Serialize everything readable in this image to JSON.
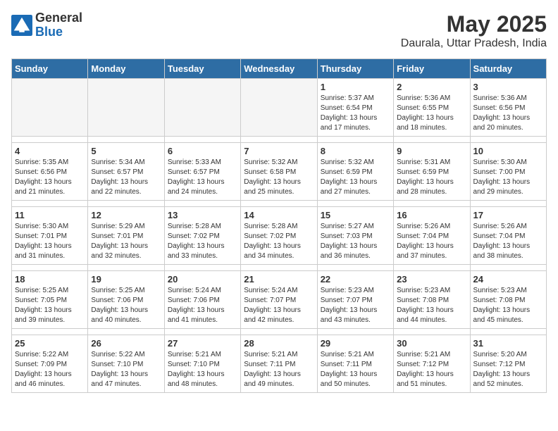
{
  "logo": {
    "general": "General",
    "blue": "Blue"
  },
  "header": {
    "title": "May 2025",
    "subtitle": "Daurala, Uttar Pradesh, India"
  },
  "weekdays": [
    "Sunday",
    "Monday",
    "Tuesday",
    "Wednesday",
    "Thursday",
    "Friday",
    "Saturday"
  ],
  "weeks": [
    [
      {
        "day": "",
        "empty": true
      },
      {
        "day": "",
        "empty": true
      },
      {
        "day": "",
        "empty": true
      },
      {
        "day": "",
        "empty": true
      },
      {
        "day": "1",
        "sunrise": "5:37 AM",
        "sunset": "6:54 PM",
        "daylight": "13 hours and 17 minutes."
      },
      {
        "day": "2",
        "sunrise": "5:36 AM",
        "sunset": "6:55 PM",
        "daylight": "13 hours and 18 minutes."
      },
      {
        "day": "3",
        "sunrise": "5:36 AM",
        "sunset": "6:56 PM",
        "daylight": "13 hours and 20 minutes."
      }
    ],
    [
      {
        "day": "4",
        "sunrise": "5:35 AM",
        "sunset": "6:56 PM",
        "daylight": "13 hours and 21 minutes."
      },
      {
        "day": "5",
        "sunrise": "5:34 AM",
        "sunset": "6:57 PM",
        "daylight": "13 hours and 22 minutes."
      },
      {
        "day": "6",
        "sunrise": "5:33 AM",
        "sunset": "6:57 PM",
        "daylight": "13 hours and 24 minutes."
      },
      {
        "day": "7",
        "sunrise": "5:32 AM",
        "sunset": "6:58 PM",
        "daylight": "13 hours and 25 minutes."
      },
      {
        "day": "8",
        "sunrise": "5:32 AM",
        "sunset": "6:59 PM",
        "daylight": "13 hours and 27 minutes."
      },
      {
        "day": "9",
        "sunrise": "5:31 AM",
        "sunset": "6:59 PM",
        "daylight": "13 hours and 28 minutes."
      },
      {
        "day": "10",
        "sunrise": "5:30 AM",
        "sunset": "7:00 PM",
        "daylight": "13 hours and 29 minutes."
      }
    ],
    [
      {
        "day": "11",
        "sunrise": "5:30 AM",
        "sunset": "7:01 PM",
        "daylight": "13 hours and 31 minutes."
      },
      {
        "day": "12",
        "sunrise": "5:29 AM",
        "sunset": "7:01 PM",
        "daylight": "13 hours and 32 minutes."
      },
      {
        "day": "13",
        "sunrise": "5:28 AM",
        "sunset": "7:02 PM",
        "daylight": "13 hours and 33 minutes."
      },
      {
        "day": "14",
        "sunrise": "5:28 AM",
        "sunset": "7:02 PM",
        "daylight": "13 hours and 34 minutes."
      },
      {
        "day": "15",
        "sunrise": "5:27 AM",
        "sunset": "7:03 PM",
        "daylight": "13 hours and 36 minutes."
      },
      {
        "day": "16",
        "sunrise": "5:26 AM",
        "sunset": "7:04 PM",
        "daylight": "13 hours and 37 minutes."
      },
      {
        "day": "17",
        "sunrise": "5:26 AM",
        "sunset": "7:04 PM",
        "daylight": "13 hours and 38 minutes."
      }
    ],
    [
      {
        "day": "18",
        "sunrise": "5:25 AM",
        "sunset": "7:05 PM",
        "daylight": "13 hours and 39 minutes."
      },
      {
        "day": "19",
        "sunrise": "5:25 AM",
        "sunset": "7:06 PM",
        "daylight": "13 hours and 40 minutes."
      },
      {
        "day": "20",
        "sunrise": "5:24 AM",
        "sunset": "7:06 PM",
        "daylight": "13 hours and 41 minutes."
      },
      {
        "day": "21",
        "sunrise": "5:24 AM",
        "sunset": "7:07 PM",
        "daylight": "13 hours and 42 minutes."
      },
      {
        "day": "22",
        "sunrise": "5:23 AM",
        "sunset": "7:07 PM",
        "daylight": "13 hours and 43 minutes."
      },
      {
        "day": "23",
        "sunrise": "5:23 AM",
        "sunset": "7:08 PM",
        "daylight": "13 hours and 44 minutes."
      },
      {
        "day": "24",
        "sunrise": "5:23 AM",
        "sunset": "7:08 PM",
        "daylight": "13 hours and 45 minutes."
      }
    ],
    [
      {
        "day": "25",
        "sunrise": "5:22 AM",
        "sunset": "7:09 PM",
        "daylight": "13 hours and 46 minutes."
      },
      {
        "day": "26",
        "sunrise": "5:22 AM",
        "sunset": "7:10 PM",
        "daylight": "13 hours and 47 minutes."
      },
      {
        "day": "27",
        "sunrise": "5:21 AM",
        "sunset": "7:10 PM",
        "daylight": "13 hours and 48 minutes."
      },
      {
        "day": "28",
        "sunrise": "5:21 AM",
        "sunset": "7:11 PM",
        "daylight": "13 hours and 49 minutes."
      },
      {
        "day": "29",
        "sunrise": "5:21 AM",
        "sunset": "7:11 PM",
        "daylight": "13 hours and 50 minutes."
      },
      {
        "day": "30",
        "sunrise": "5:21 AM",
        "sunset": "7:12 PM",
        "daylight": "13 hours and 51 minutes."
      },
      {
        "day": "31",
        "sunrise": "5:20 AM",
        "sunset": "7:12 PM",
        "daylight": "13 hours and 52 minutes."
      }
    ]
  ]
}
